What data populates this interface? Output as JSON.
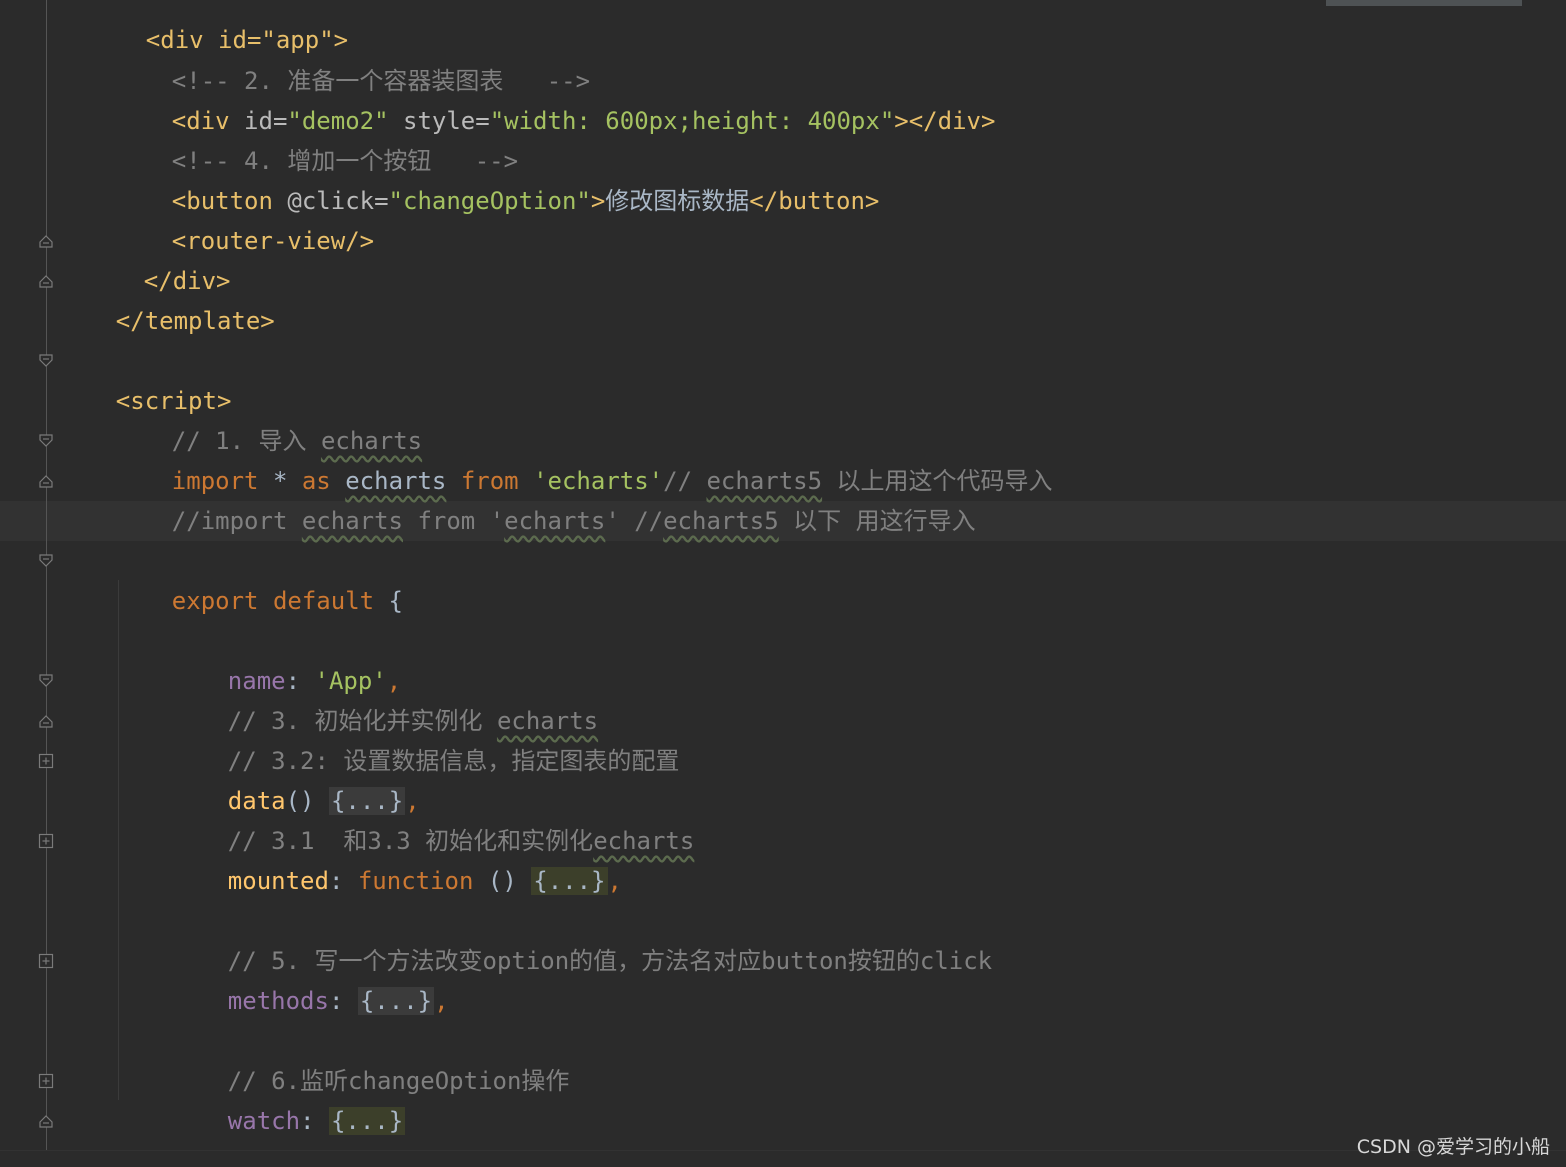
{
  "editor": {
    "lines": {
      "l0": "<div id=\"app\">",
      "l1_comment": "<!-- 2. 准备一个容器装图表   -->",
      "l2_tag_open": "<div",
      "l2_attr_id": " id=",
      "l2_str_id": "\"demo2\"",
      "l2_attr_style": " style=",
      "l2_str_style": "\"width: 600px;height: 400px\"",
      "l2_tag_close": "></div>",
      "l3_comment": "<!-- 4. 增加一个按钮   -->",
      "l4_tag_open": "<button",
      "l4_attr": " @click=",
      "l4_str": "\"changeOption\"",
      "l4_gt": ">",
      "l4_text": "修改图标数据",
      "l4_tag_close": "</button>",
      "l5": "<router-view/>",
      "l6": "</div>",
      "l7": "</template>",
      "l9": "<script>",
      "l10_prefix": "// 1. 导入 ",
      "l10_word": "echarts",
      "l11_import": "import",
      "l11_star": " * ",
      "l11_as": "as",
      "l11_sp": " ",
      "l11_name": "echarts",
      "l11_sp2": " ",
      "l11_from": "from",
      "l11_sp3": " ",
      "l11_str": "'echarts'",
      "l11_c1": "// ",
      "l11_c2": "echarts5",
      "l11_c3": " 以上用这个代码导入",
      "l12_a": "//import ",
      "l12_b": "echarts",
      "l12_c": " from '",
      "l12_d": "echarts",
      "l12_e": "' //",
      "l12_f": "echarts5",
      "l12_g": " 以下 用这行导入",
      "l14_export": "export default",
      "l14_brace": " {",
      "l16_name": "name",
      "l16_colon": ": ",
      "l16_str": "'App'",
      "l16_comma": ",",
      "l17_prefix": "// 3. 初始化并实例化 ",
      "l17_word": "echarts",
      "l18": "// 3.2: 设置数据信息，指定图表的配置",
      "l19_fn": "data",
      "l19_paren": "() ",
      "l19_fold": "{...}",
      "l19_comma": ",",
      "l20_prefix": "// 3.1  和3.3 初始化和实例化",
      "l20_word": "echarts",
      "l21_fn": "mounted",
      "l21_colon": ": ",
      "l21_kw": "function",
      "l21_paren": " () ",
      "l21_fold": "{...}",
      "l21_comma": ",",
      "l23": "// 5. 写一个方法改变option的值，方法名对应button按钮的click",
      "l24_prop": "methods",
      "l24_colon": ": ",
      "l24_fold": "{...}",
      "l24_comma": ",",
      "l26": "// 6.监听changeOption操作",
      "l27_prop": "watch",
      "l27_colon": ": ",
      "l27_fold": "{...}",
      "l28": "}",
      "l29": "}"
    }
  },
  "watermark": "CSDN @爱学习的小船"
}
